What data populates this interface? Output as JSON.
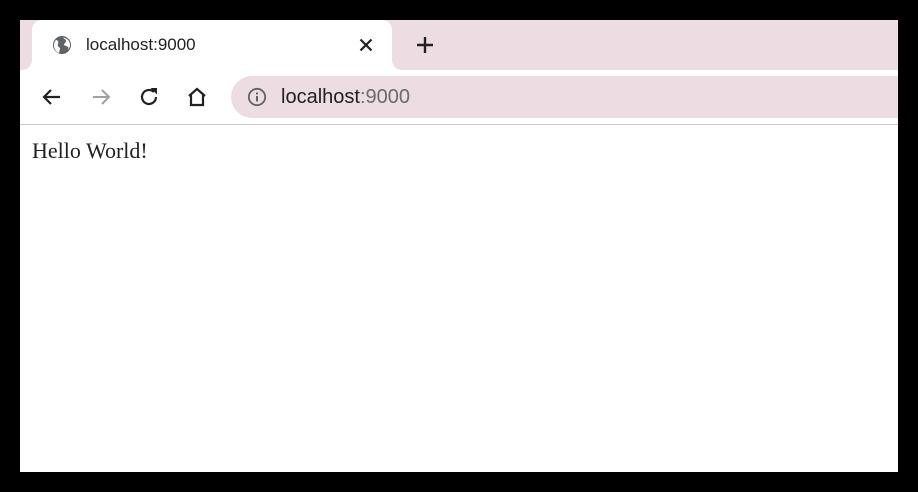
{
  "browser": {
    "tab": {
      "title": "localhost:9000",
      "favicon": "globe-icon",
      "close_icon": "close-icon"
    },
    "new_tab_icon": "plus-icon",
    "toolbar": {
      "back_icon": "arrow-left-icon",
      "forward_icon": "arrow-right-icon",
      "reload_icon": "reload-icon",
      "home_icon": "home-icon"
    },
    "omnibox": {
      "info_icon": "info-icon",
      "host": "localhost",
      "port": ":9000"
    },
    "colors": {
      "chrome_bg": "#eddde3",
      "text": "#202124",
      "muted": "#6b6b6b",
      "disabled": "#a0a0a0"
    }
  },
  "page": {
    "body_text": "Hello World!"
  }
}
